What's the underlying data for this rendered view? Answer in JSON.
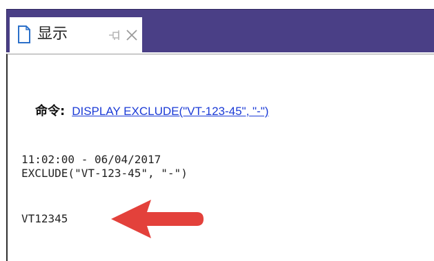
{
  "tab": {
    "label": "显示",
    "doc_icon": "document-icon",
    "pin_icon": "pin-icon",
    "close_icon": "close-icon"
  },
  "command": {
    "label": "命令:",
    "link_text": "DISPLAY EXCLUDE(\"VT-123-45\", \"-\")"
  },
  "output": {
    "timestamp_line": "11:02:00 - 06/04/2017",
    "expression_line": "EXCLUDE(\"VT-123-45\", \"-\")",
    "result_line": "VT12345"
  },
  "annotation": {
    "arrow_icon": "left-arrow-icon",
    "arrow_color": "#e3413b"
  },
  "colors": {
    "tabstrip_band": "#4a3f86",
    "link": "#1a3ad6"
  }
}
